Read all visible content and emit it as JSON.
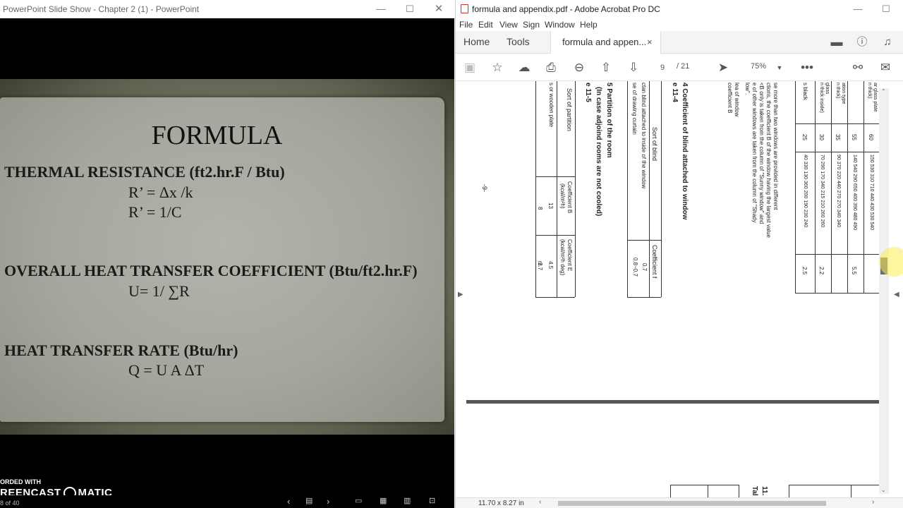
{
  "ppt": {
    "window_title": "PowerPoint Slide Show  -  Chapter 2 (1) - PowerPoint",
    "slide": {
      "title": "FORMULA",
      "line1": "THERMAL RESISTANCE (ft2.hr.F / Btu)",
      "line2": "R’ = Δx /k",
      "line3": "R’ = 1/C",
      "line4": "OVERALL HEAT TRANSFER COEFFICIENT (Btu/ft2.hr.F)",
      "line5": "U= 1/ ∑R",
      "line6": "HEAT TRANSFER RATE (Btu/hr)",
      "line7": "Q = U A ΔT"
    },
    "slide_counter": "8 of 40",
    "watermark_top": "ORDED WITH",
    "watermark_left": "REENCAST",
    "watermark_right": "MATIC"
  },
  "acrobat": {
    "window_title": "formula and appendix.pdf - Adobe Acrobat Pro DC",
    "menu": [
      "File",
      "Edit",
      "View",
      "Sign",
      "Window",
      "Help"
    ],
    "tabs": {
      "home": "Home",
      "tools": "Tools",
      "doc": "formula and appen...",
      "close": "×"
    },
    "page": {
      "current": "9",
      "total": "/ 21"
    },
    "zoom": "75%",
    "page_size": "11.70 x 8.27 in",
    "doc_text": {
      "h11_4": "4  Coefficient of blind attached to window",
      "h11_4b": "e 11-4",
      "sort_blind": "Sort of blind",
      "coef_f": "Coefficient  f",
      "blind_inside": "ctan blind attached to inside of the window",
      "curtain": "se of drawing curtain",
      "v07": "0.7",
      "v0806": "0.8~0.7",
      "h11_5": "5  Partition of the room",
      "h11_5b": "(In case adjoind rooms are not cooled)",
      "h11_5c": "e 11-5",
      "sort_partition": "Sort of partition",
      "coef_B": "Coefficient  B",
      "coef_B_unit": "(kcal/m²h)",
      "coef_E": "Coefficient  E",
      "coef_E_unit": "(kcal/m²h deg)",
      "wooden": "s or wooden plate",
      "rs": "rs",
      "v13": "13",
      "v8": "8",
      "v45": "4.5",
      "v27": "2.7",
      "p1": "se more than two windows are provided in different",
      "p2": "ctions, the coefficient B of the window having the largest value",
      "p3": "<B only is taken from the column of \"Sunny window\" and",
      "p4": "e of other windows are taken from the column of \"Shady",
      "p5": "low\".",
      "p6": "lea of window",
      "p7": "coefficient B",
      "c1": "s black",
      "c2": "glass",
      "c3": "n thick inside)",
      "c4": "ation type",
      "c5": "n thick)",
      "c6": "ar glass plate",
      "c7": "n thick)",
      "n25": "25",
      "n30": "30",
      "n35": "35",
      "n55": "55",
      "n60": "60",
      "r1": "40 330 130 360 200 190 230 240",
      "r2": "70 290 170 340 215 210 260 260",
      "r3": "90 370 220 440 270 270 340 340",
      "r4": "140 540 290 650 400 390 480 490",
      "r5": "150 530 310 710 440 430 530 540",
      "n25b": "2.5",
      "n22": "2.2",
      "n55b": "5.5",
      "pgnum": "-9-",
      "t11": "11.",
      "tal": "Tal"
    }
  }
}
